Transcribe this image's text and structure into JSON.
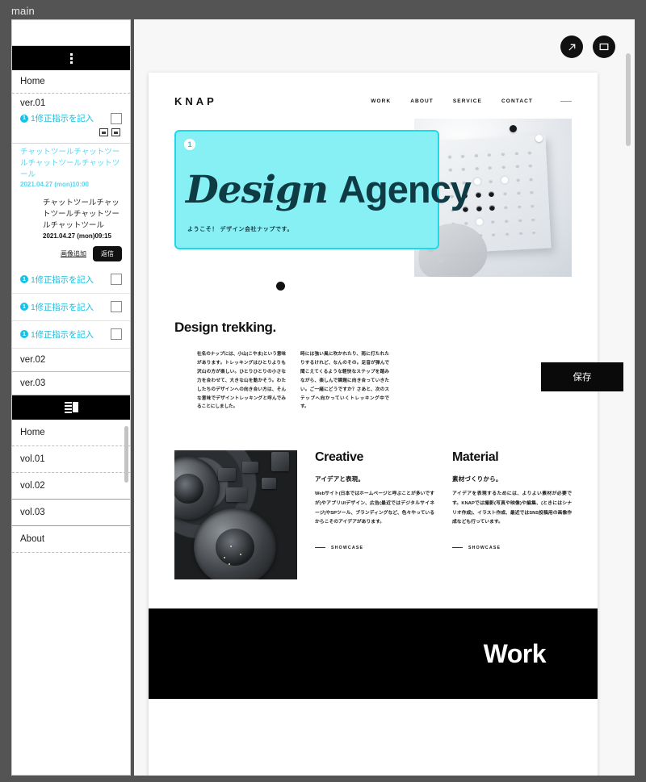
{
  "window": {
    "title": "main"
  },
  "sidebar": {
    "menu_icon": "kebab-menu-icon",
    "home_label": "Home",
    "versions": [
      {
        "label": "ver.01"
      },
      {
        "label": "ver.02"
      },
      {
        "label": "ver.03"
      }
    ],
    "fix_badge": "1",
    "fix_label": "1修正指示を記入",
    "fix_rows": [
      {
        "badge": "1",
        "label": "1修正指示を記入"
      },
      {
        "badge": "1",
        "label": "1修正指示を記入"
      },
      {
        "badge": "1",
        "label": "1修正指示を記入"
      }
    ],
    "mini_icons": [
      "frame-icon",
      "frame-icon"
    ],
    "chat": {
      "incoming_text": "チャットツールチャットツールチャットツールチャットツール",
      "incoming_time": "2021.04.27 (mon)10:00",
      "outgoing_text": "チャットツールチャットツールチャットツールチャットツール",
      "outgoing_time": "2021.04.27 (mon)09:15",
      "add_image_label": "画像追加",
      "send_label": "返信"
    },
    "layout_icon": "layout-panel-icon",
    "lower_home_label": "Home",
    "volumes": [
      {
        "label": "vol.01"
      },
      {
        "label": "vol.02"
      },
      {
        "label": "vol.03"
      }
    ],
    "about_label": "About"
  },
  "stage": {
    "tools": [
      {
        "name": "open-external-icon",
        "label": "open-external"
      },
      {
        "name": "window-preview-icon",
        "label": "window-preview"
      }
    ],
    "save_label": "保存"
  },
  "site": {
    "brand": "KNAP",
    "nav": [
      "WORK",
      "ABOUT",
      "SERVICE",
      "CONTACT"
    ],
    "hero": {
      "marker": "1",
      "title_script": "Design",
      "title_plain": "Agency",
      "subtitle": "ようこそ！ デザイン会社ナップです。"
    },
    "trekking": {
      "heading": "Design trekking.",
      "col1": "社名のナップには、小山(こやま)という意味があります。トレッキングはひとりよりも沢山の方が楽しい。ひとりひとりの小さな力を合わせて、大きな山を動かそう。わたしたちのデザインへの向き合い方は、そんな意味でデザイントレッキングと呼んでみることにしました。",
      "col2": "時には強い風に吹かれたり、雨に打たれたりするけれど、なんのその。足音が弾んで聞こえてくるような軽快なステップを踏みながら、楽しんで課題に向き合っていきたい。ご一緒にどうですか？さあと、次のステップへ向かっていくトレッキング中です。"
    },
    "columns": [
      {
        "heading": "Creative",
        "lead": "アイデアと表現。",
        "body": "Webサイト(日本ではホームページと呼ぶことが多いですが)やアプリUIデザイン、広告(最近ではデジタルサイネージ)やSPツール、ブランディングなど、色々やっているからこそのアイデアがあります。",
        "link": "SHOWCASE"
      },
      {
        "heading": "Material",
        "lead": "素材づくりから。",
        "body": "アイデアを表現するためには、よりよい素材が必要です。KNAPでは撮影(写真や映像)や編集、(ときにはシナリオ作成)、イラスト作成、最近ではSNS投稿用の画像作成なども行っています。",
        "link": "SHOWCASE"
      }
    ],
    "work_band": "Work"
  },
  "colors": {
    "accent_cyan": "#17bfe0",
    "hero_cyan": "#87f0f5",
    "hero_border": "#1fd9e8",
    "black": "#000000",
    "chrome": "#545454"
  }
}
